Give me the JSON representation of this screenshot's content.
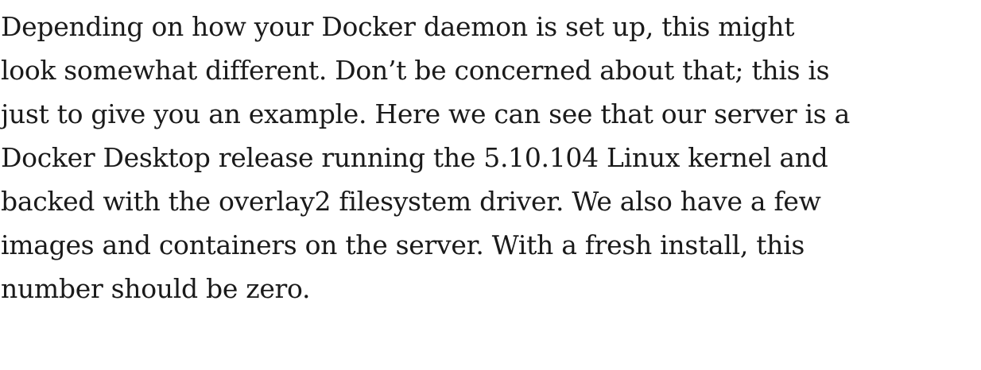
{
  "document": {
    "paragraph_lines": [
      "Depending on how your Docker daemon is set up, this might",
      "look somewhat different. Don’t be concerned about that; this is",
      "just to give you an example. Here we can see that our server is a",
      "Docker Desktop release running the 5.10.104 Linux kernel and",
      "backed with the overlay2 filesystem driver. We also have a few",
      "images and containers on the server. With a fresh install, this",
      "number should be zero."
    ]
  }
}
